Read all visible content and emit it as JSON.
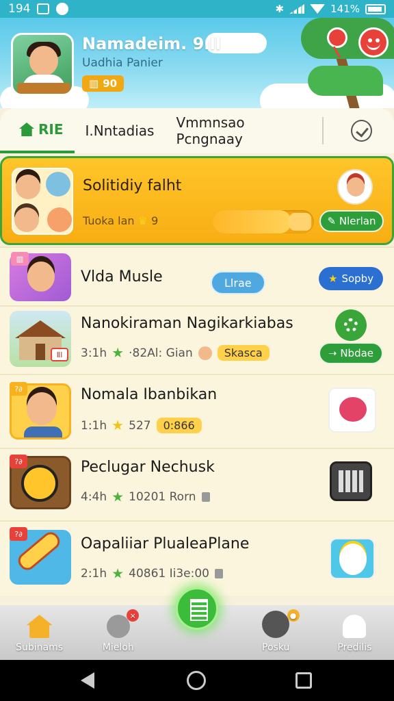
{
  "status_bar": {
    "time": "194",
    "battery": "141%"
  },
  "header": {
    "title": "Namadeim. 9ıll",
    "subtitle": "Uadhia Panier",
    "badge": "90"
  },
  "tabs": [
    {
      "label": "RIE"
    },
    {
      "label": "I.Nntadias"
    },
    {
      "label": "Vmmnsao Pcngnaay"
    }
  ],
  "featured": {
    "title": "Solitidiy falht",
    "meta": "Tuoka lan",
    "meta_count": "9",
    "progress": 0.78,
    "action_label": "Nlerlan"
  },
  "items": [
    {
      "title": "Vlda Musle",
      "pill": "Llrae",
      "side_label": "Sopby"
    },
    {
      "title": "Nanokiraman Nagikarkiabas",
      "meta_time": "3:1h",
      "meta_count": "·82Al: Gian",
      "tag": "Skasca",
      "action_label": "Nbdae"
    },
    {
      "title": "Nomala Ibanbikan",
      "meta_time": "1:1h",
      "meta_count": "527",
      "tag": "0:866"
    },
    {
      "title": "Peclugar Nechusk",
      "meta_time": "4:4h",
      "meta_count": "10201 Rorn"
    },
    {
      "title": "Oapaliiar PlualeaPlane",
      "meta_time": "2:1h",
      "meta_count": "40861 Ii3e:00"
    }
  ],
  "bottom_nav": [
    {
      "label": "Subinams"
    },
    {
      "label": "Mieloh"
    },
    {
      "label": ""
    },
    {
      "label": "Posku"
    },
    {
      "label": "Predilis"
    }
  ],
  "colors": {
    "accent_green": "#2e9e3a",
    "featured_bg": "#ffc52a",
    "header_sky": "#59c9ea"
  }
}
